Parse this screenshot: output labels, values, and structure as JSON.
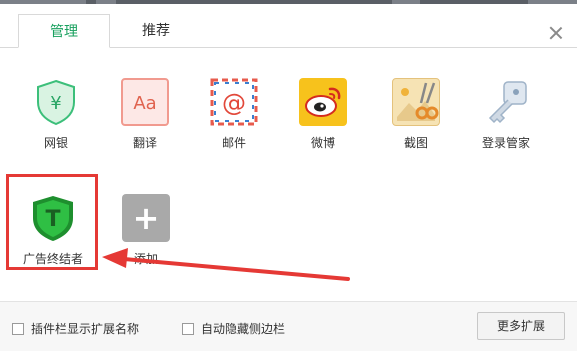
{
  "tabs": [
    {
      "label": "管理",
      "active": true
    },
    {
      "label": "推荐",
      "active": false
    }
  ],
  "extensions": [
    {
      "label": "网银",
      "icon": "bank-shield-icon"
    },
    {
      "label": "翻译",
      "icon": "translate-icon"
    },
    {
      "label": "邮件",
      "icon": "mail-icon"
    },
    {
      "label": "微博",
      "icon": "weibo-icon"
    },
    {
      "label": "截图",
      "icon": "screenshot-icon"
    },
    {
      "label": "登录管家",
      "icon": "key-icon"
    },
    {
      "label": "广告终结者",
      "icon": "adblock-shield-icon"
    },
    {
      "label": "添加",
      "icon": "plus-icon"
    }
  ],
  "footer": {
    "show_names_label": "插件栏显示扩展名称",
    "auto_hide_label": "自动隐藏侧边栏",
    "more_label": "更多扩展"
  },
  "icon_glyphs": {
    "bank": "¥",
    "translate": "Aa",
    "mail": "@",
    "adblock": "T",
    "plus": "+"
  },
  "colors": {
    "accent_green": "#18a05e",
    "annotation_red": "#e53935"
  }
}
